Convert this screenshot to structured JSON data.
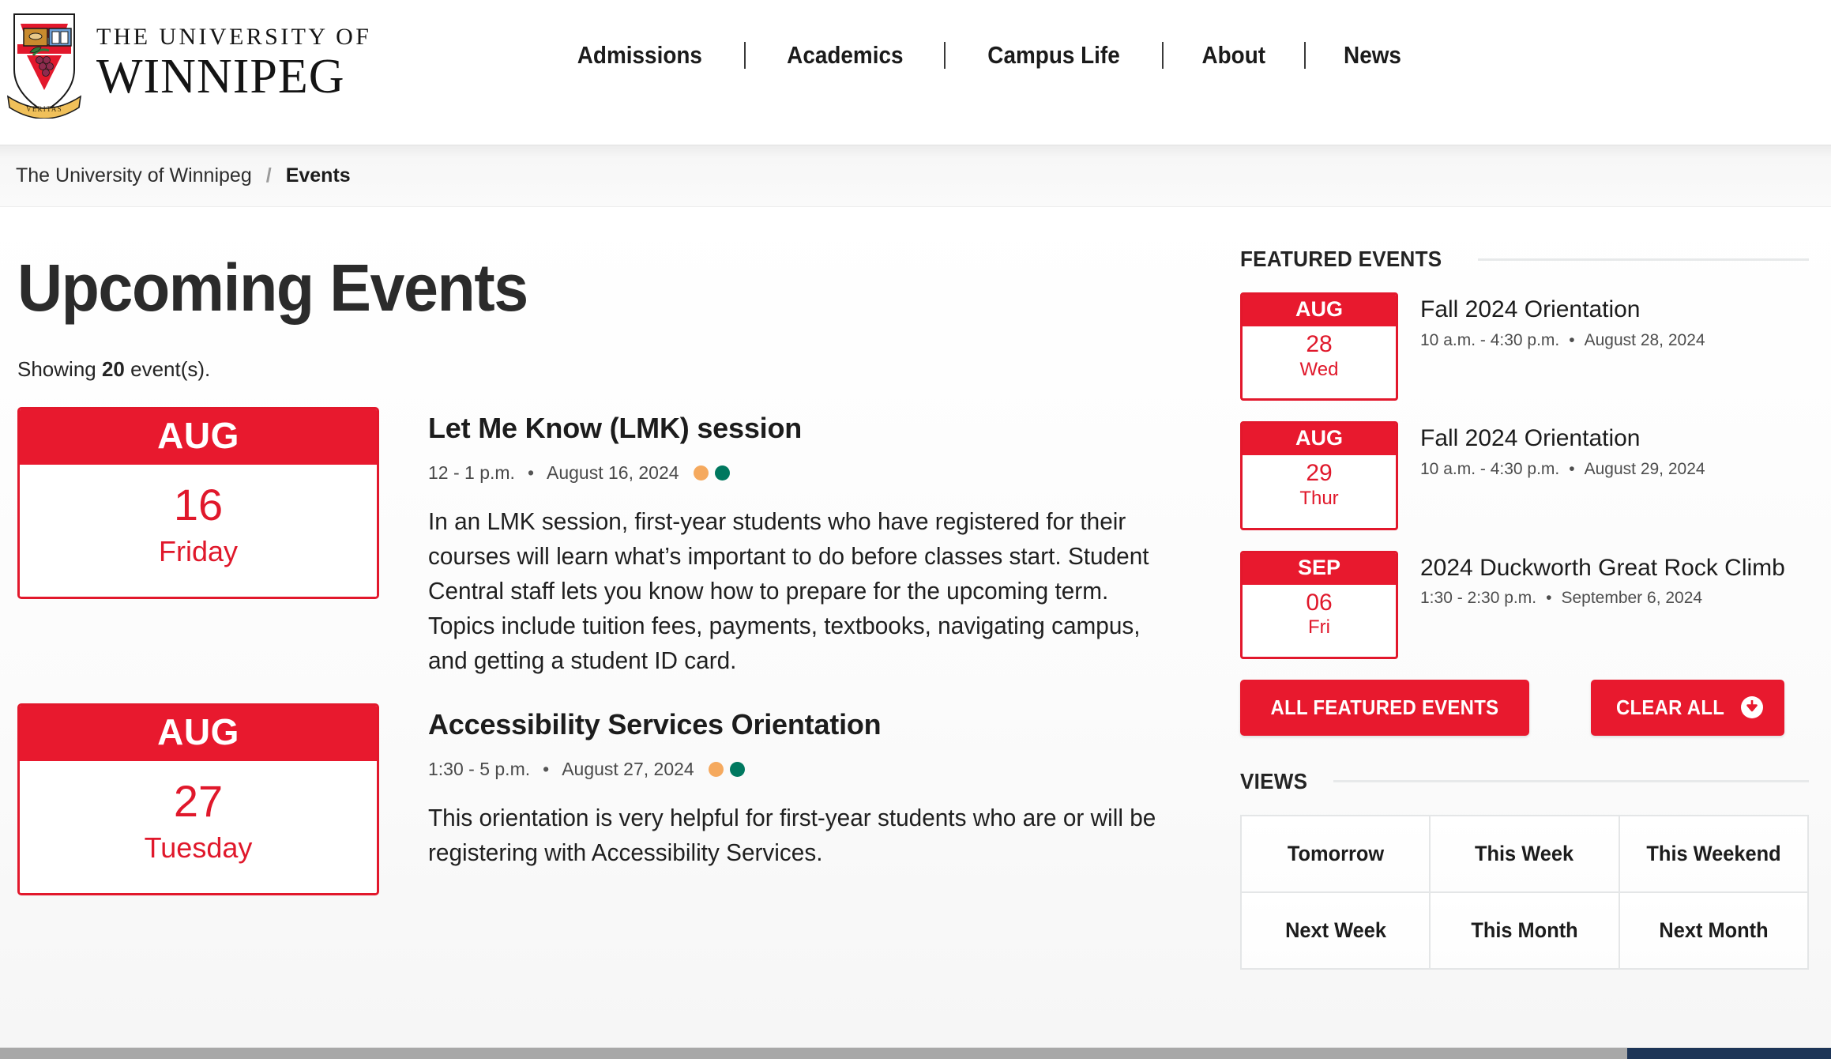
{
  "header": {
    "logo": {
      "line1": "THE UNIVERSITY OF",
      "line2": "WINNIPEG",
      "crest_alt": "university-crest",
      "motto": "VERITAS"
    },
    "nav": [
      {
        "label": "Admissions"
      },
      {
        "label": "Academics"
      },
      {
        "label": "Campus Life"
      },
      {
        "label": "About"
      },
      {
        "label": "News"
      }
    ],
    "nav_separator": "|"
  },
  "breadcrumb": {
    "home": "The University of Winnipeg",
    "separator": "/",
    "current": "Events"
  },
  "main": {
    "title": "Upcoming Events",
    "showing_prefix": "Showing ",
    "showing_count": "20",
    "showing_suffix": " event(s).",
    "events": [
      {
        "month": "AUG",
        "day": "16",
        "weekday": "Friday",
        "title": "Let Me Know (LMK) session",
        "time": "12 - 1 p.m.",
        "sep": "•",
        "date": "August 16, 2024",
        "tags": [
          "#F5A95E",
          "#00785F"
        ],
        "description": "In an LMK session, first-year students who have registered for their courses will learn what’s important to do before classes start. Student Central staff lets you know how to prepare for the upcoming term. Topics include tuition fees, payments, textbooks, navigating campus, and getting a student ID card."
      },
      {
        "month": "AUG",
        "day": "27",
        "weekday": "Tuesday",
        "title": "Accessibility Services Orientation",
        "time": "1:30 - 5 p.m.",
        "sep": "•",
        "date": "August 27, 2024",
        "tags": [
          "#F5A95E",
          "#00785F"
        ],
        "description": "This orientation is very helpful for first-year students who are or will be registering with Accessibility Services."
      }
    ]
  },
  "sidebar": {
    "featured_heading": "FEATURED EVENTS",
    "featured": [
      {
        "month": "AUG",
        "day": "28",
        "weekday": "Wed",
        "title": "Fall 2024 Orientation",
        "time": "10 a.m. - 4:30 p.m.",
        "sep": "•",
        "date": "August 28, 2024"
      },
      {
        "month": "AUG",
        "day": "29",
        "weekday": "Thur",
        "title": "Fall 2024 Orientation",
        "time": "10 a.m. - 4:30 p.m.",
        "sep": "•",
        "date": "August 29, 2024"
      },
      {
        "month": "SEP",
        "day": "06",
        "weekday": "Fri",
        "title": "2024 Duckworth Great Rock Climb",
        "time": "1:30 - 2:30 p.m.",
        "sep": "•",
        "date": "September 6, 2024"
      }
    ],
    "all_featured_label": "ALL FEATURED EVENTS",
    "clear_all_label": "CLEAR ALL",
    "views_heading": "VIEWS",
    "views": [
      {
        "label": "Tomorrow"
      },
      {
        "label": "This Week"
      },
      {
        "label": "This Weekend"
      },
      {
        "label": "Next Week"
      },
      {
        "label": "This Month"
      },
      {
        "label": "Next Month"
      }
    ]
  },
  "colors": {
    "brand_red": "#E8192E",
    "tag_orange": "#F5A95E",
    "tag_teal": "#00785F",
    "text_dark": "#1C1C1C"
  }
}
